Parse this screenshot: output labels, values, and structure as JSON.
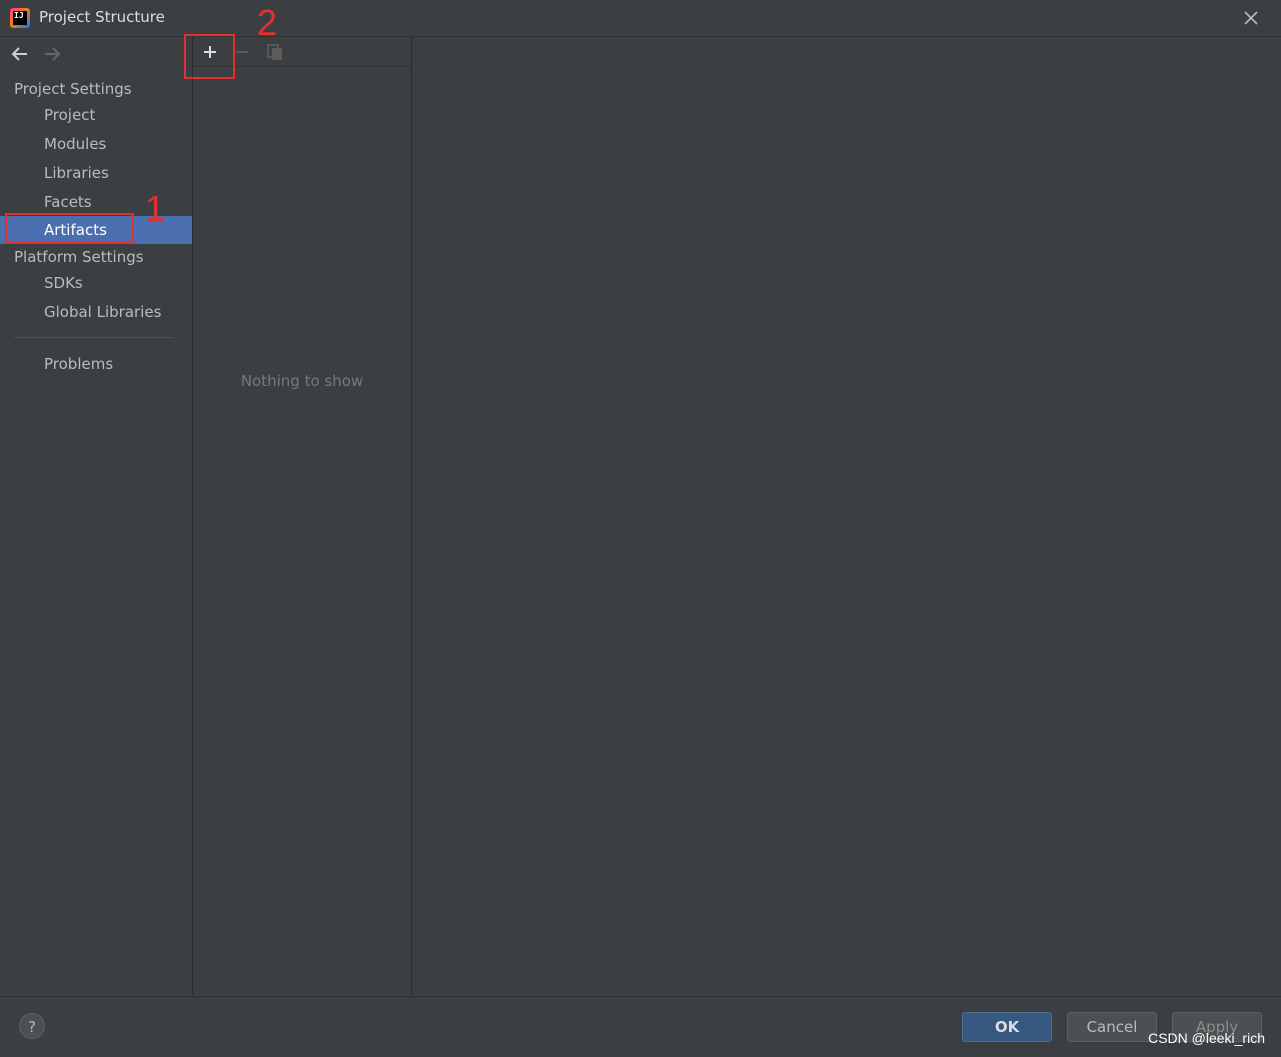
{
  "window": {
    "title": "Project Structure"
  },
  "sidebar": {
    "sections": [
      {
        "header": "Project Settings",
        "items": [
          "Project",
          "Modules",
          "Libraries",
          "Facets",
          "Artifacts"
        ]
      },
      {
        "header": "Platform Settings",
        "items": [
          "SDKs",
          "Global Libraries"
        ]
      }
    ],
    "problems": "Problems",
    "selected": "Artifacts"
  },
  "list": {
    "empty_text": "Nothing to show"
  },
  "footer": {
    "help": "?",
    "ok": "OK",
    "cancel": "Cancel",
    "apply": "Apply"
  },
  "annotations": {
    "step1": "1",
    "step2": "2"
  },
  "watermark": "CSDN @leeki_rich",
  "colors": {
    "selection": "#4b6eaf",
    "annotation": "#e0302f",
    "ok_button": "#365880"
  }
}
